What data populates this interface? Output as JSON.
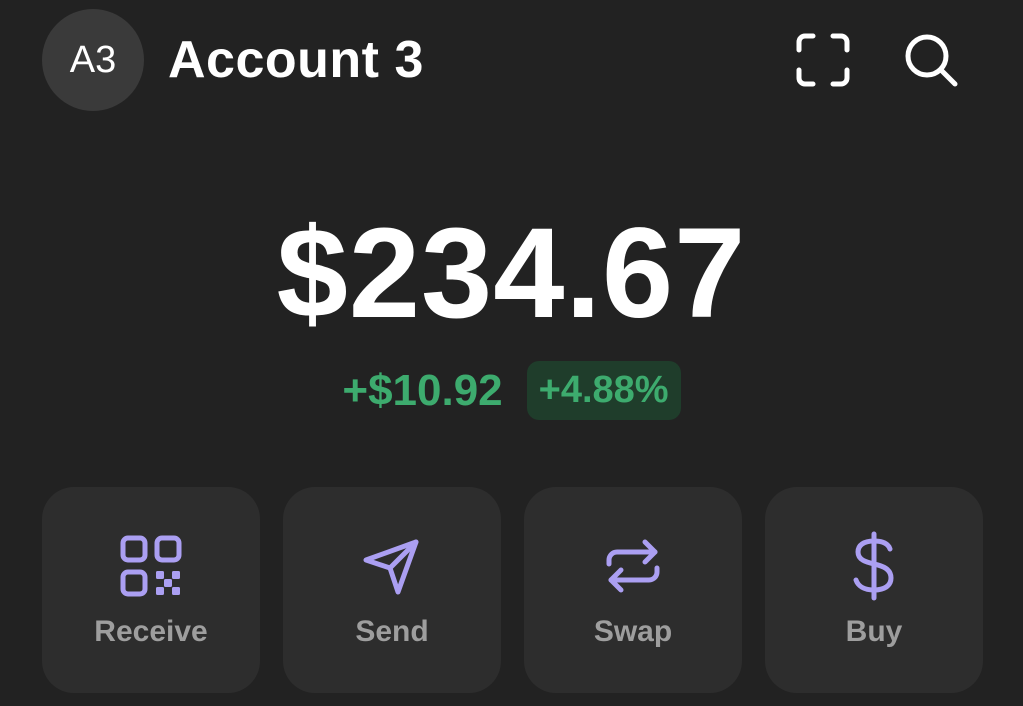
{
  "header": {
    "avatar_initials": "A3",
    "account_name": "Account 3",
    "icons": [
      "scan-icon",
      "search-icon"
    ]
  },
  "balance": {
    "total": "$234.67",
    "change_amount": "+$10.92",
    "change_percent": "+4.88%"
  },
  "actions": [
    {
      "label": "Receive",
      "icon": "qr-code-icon"
    },
    {
      "label": "Send",
      "icon": "paper-plane-icon"
    },
    {
      "label": "Swap",
      "icon": "swap-arrows-icon"
    },
    {
      "label": "Buy",
      "icon": "dollar-icon"
    }
  ],
  "colors": {
    "background": "#222222",
    "card": "#2d2d2d",
    "accent": "#ab9ff2",
    "positive": "#3dab6e",
    "positive_bg": "#1f3d2b",
    "muted_text": "#9e9e9e"
  }
}
